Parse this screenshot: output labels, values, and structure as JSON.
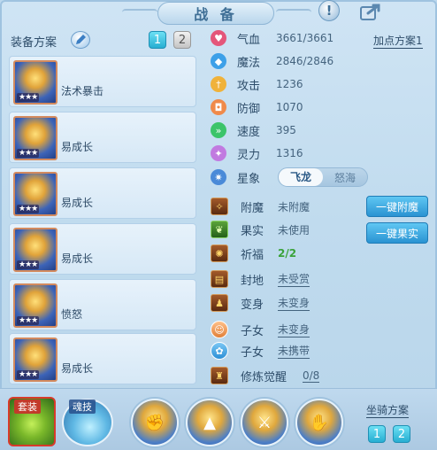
{
  "title": "战 备",
  "icons": {
    "info": "info-icon",
    "share": "share-icon",
    "edit": "pencil-icon"
  },
  "colors": {
    "active": "#27aed2",
    "accent": "#2a93d2",
    "text": "#2e4d6a"
  },
  "equip": {
    "label": "装备方案",
    "plans": [
      "1",
      "2"
    ],
    "active_plan": "1",
    "items": [
      {
        "stars": "★★★",
        "effect": "法术暴击"
      },
      {
        "stars": "★★★",
        "effect": "易成长"
      },
      {
        "stars": "★★★",
        "effect": "易成长"
      },
      {
        "stars": "★★★",
        "effect": "易成长"
      },
      {
        "stars": "★★★",
        "effect": "愤怒"
      },
      {
        "stars": "★★★",
        "effect": "易成长"
      }
    ]
  },
  "stats": {
    "add_plan": "加点方案1",
    "rows": [
      {
        "name": "气血",
        "value": "3661/3661",
        "icon": "heart-icon",
        "color": "#e4567a"
      },
      {
        "name": "魔法",
        "value": "2846/2846",
        "icon": "mana-icon",
        "color": "#3da0e8"
      },
      {
        "name": "攻击",
        "value": "1236",
        "icon": "sword-icon",
        "color": "#f0b23a"
      },
      {
        "name": "防御",
        "value": "1070",
        "icon": "shield-icon",
        "color": "#f08a4a"
      },
      {
        "name": "速度",
        "value": "395",
        "icon": "speed-icon",
        "color": "#3cc46a"
      },
      {
        "name": "灵力",
        "value": "1316",
        "icon": "spirit-icon",
        "color": "#c17ae0"
      }
    ]
  },
  "xingxiang": {
    "label": "星象",
    "options": [
      "飞龙",
      "怒海"
    ],
    "selected": "飞龙"
  },
  "extras": [
    {
      "name": "附魔",
      "value": "未附魔",
      "style": "plain"
    },
    {
      "name": "果实",
      "value": "未使用",
      "style": "plain"
    },
    {
      "name": "祈福",
      "value": "2/2",
      "style": "green"
    },
    {
      "name": "封地",
      "value": "未受赏",
      "style": "underline"
    },
    {
      "name": "变身",
      "value": "未变身",
      "style": "underline"
    },
    {
      "name": "子女",
      "value": "未变身",
      "style": "underline"
    },
    {
      "name": "子女",
      "value": "未携带",
      "style": "underline"
    },
    {
      "name": "修炼觉醒",
      "value": "0/8",
      "style": "underline"
    }
  ],
  "actions": {
    "enchant": "一键附魔",
    "fruit": "一键果实"
  },
  "bottom": {
    "suit": "套装",
    "skill": "魂技",
    "mount_label": "坐骑方案",
    "mount_plans": [
      "1",
      "2"
    ],
    "active_mount_plan": "2"
  }
}
